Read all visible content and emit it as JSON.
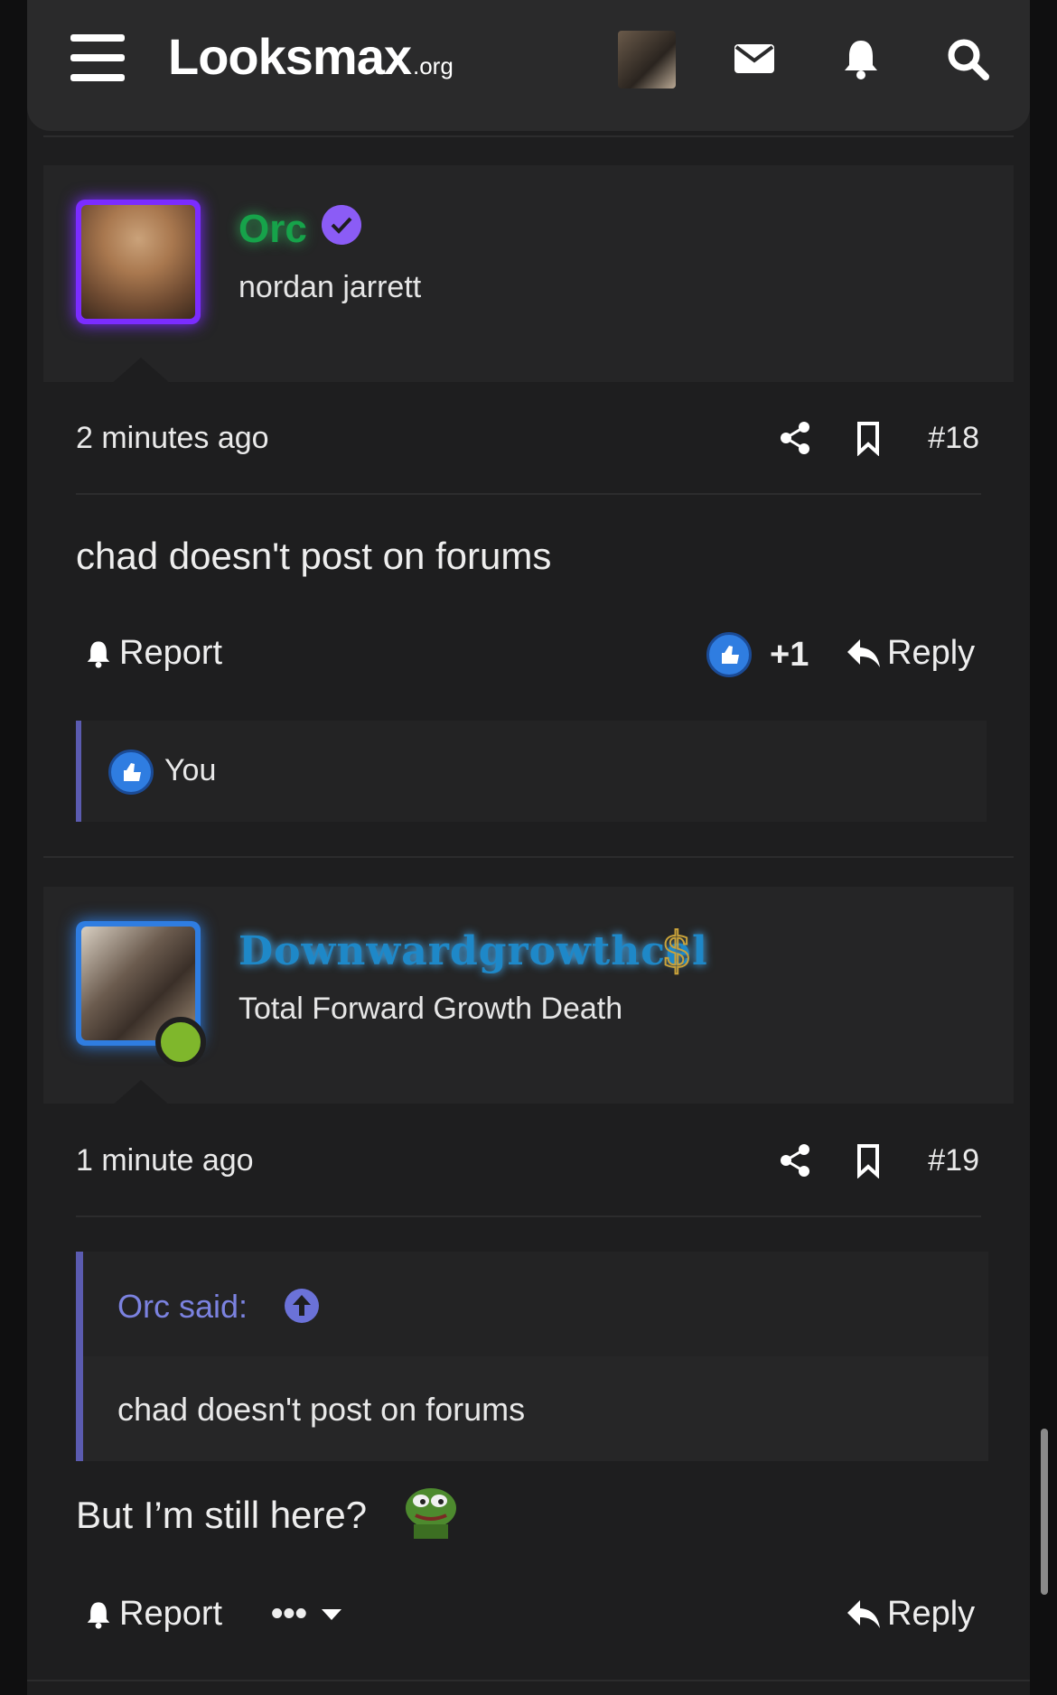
{
  "header": {
    "logo_main": "Looksmax",
    "logo_suffix": ".org",
    "icons": [
      "menu-icon",
      "envelope-icon",
      "bell-icon",
      "search-icon"
    ]
  },
  "posts": [
    {
      "username": "Orc",
      "user_title": "nordan jarrett",
      "username_color": "#1aa33c",
      "time": "2 minutes ago",
      "post_number": "#18",
      "body": "chad doesn't post on forums",
      "report_label": "Report",
      "like_count": "+1",
      "reply_label": "Reply",
      "reactions_label": "You"
    },
    {
      "username": "Downwardgrowthcel",
      "user_title": "Total Forward Growth Death",
      "username_color": "#2f9fdc",
      "time": "1 minute ago",
      "post_number": "#19",
      "quote_author": "Orc said:",
      "quote_body": "chad doesn't post on forums",
      "body": "But I’m still here?",
      "report_label": "Report",
      "more_label": "•••",
      "reply_label": "Reply"
    }
  ]
}
